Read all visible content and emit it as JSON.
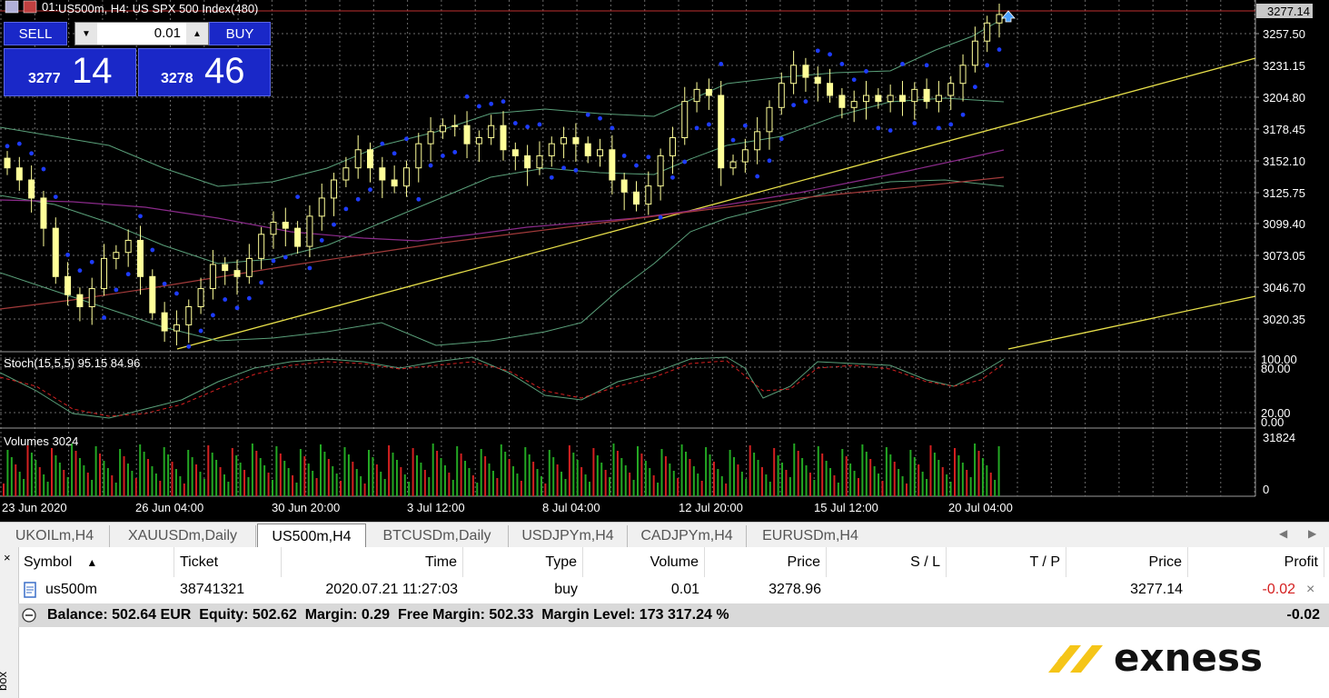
{
  "window": {
    "title": "US500m, H4:  US SPX 500 Index(480)",
    "title_prefix": "01:",
    "current_price_tag": "3277.14"
  },
  "one_click": {
    "sell_label": "SELL",
    "buy_label": "BUY",
    "lot": "0.01",
    "bid_small": "3277",
    "bid_big": "14",
    "ask_small": "3278",
    "ask_big": "46",
    "arrow_down": "▼",
    "arrow_up": "▲"
  },
  "price_axis": [
    "3257.50",
    "3231.15",
    "3204.80",
    "3178.45",
    "3152.10",
    "3125.75",
    "3099.40",
    "3073.05",
    "3046.70",
    "3020.35"
  ],
  "time_axis": [
    "23 Jun 2020",
    "26 Jun 04:00",
    "30 Jun 20:00",
    "3 Jul 12:00",
    "8 Jul 04:00",
    "12 Jul 20:00",
    "15 Jul 12:00",
    "20 Jul 04:00"
  ],
  "stochastic": {
    "label": "Stoch(15,5,5) 95.15 84.96",
    "levels": [
      "100.00",
      "80.00",
      "20.00",
      "0.00"
    ]
  },
  "volumes": {
    "label": "Volumes 3024",
    "levels": [
      "31824",
      "0"
    ]
  },
  "colors": {
    "bull_candle": "#ffff99",
    "bear_candle": "#ffff99",
    "parabolic_sar": "#1e3cff",
    "bollinger": "#5aa07a",
    "trendline": "#e8e04a",
    "ma_purple": "#8a2a8a",
    "ma_red": "#a23a3a",
    "stoch_main": "#5aa07a",
    "stoch_signal": "#d42020",
    "volume_up": "#23a823",
    "volume_down": "#d42020",
    "button_blue": "#1a28c8"
  },
  "chart_data": {
    "type": "candlestick",
    "symbol": "US500m",
    "timeframe": "H4",
    "ylim": [
      3000,
      3280
    ],
    "close_points": [
      3150,
      3140,
      3125,
      3100,
      3060,
      3045,
      3035,
      3050,
      3075,
      3080,
      3090,
      3060,
      3030,
      3015,
      3020,
      3035,
      3050,
      3070,
      3065,
      3060,
      3075,
      3095,
      3105,
      3100,
      3085,
      3110,
      3125,
      3140,
      3150,
      3165,
      3150,
      3140,
      3135,
      3150,
      3170,
      3180,
      3185,
      3185,
      3170,
      3175,
      3185,
      3165,
      3160,
      3150,
      3160,
      3170,
      3175,
      3170,
      3160,
      3165,
      3140,
      3130,
      3120,
      3135,
      3160,
      3175,
      3205,
      3215,
      3210,
      3150,
      3155,
      3165,
      3180,
      3200,
      3220,
      3235,
      3225,
      3220,
      3210,
      3200,
      3205,
      3210,
      3205,
      3210,
      3205,
      3215,
      3205,
      3210,
      3220,
      3235,
      3255,
      3270,
      3277
    ]
  },
  "tabs": [
    "UKOILm,H4",
    "XAUUSDm,Daily",
    "US500m,H4",
    "BTCUSDm,Daily",
    "USDJPYm,H4",
    "CADJPYm,H4",
    "EURUSDm,H4"
  ],
  "tab_nav": {
    "left": "◀",
    "right": "▶"
  },
  "terminal": {
    "close": "×",
    "side_label": "box",
    "sort_arrow": "▲",
    "headers": [
      "Symbol",
      "Ticket",
      "Time",
      "Type",
      "Volume",
      "Price",
      "S / L",
      "T / P",
      "Price",
      "Profit"
    ],
    "row": {
      "symbol": "us500m",
      "ticket": "38741321",
      "time": "2020.07.21 11:27:03",
      "type": "buy",
      "volume": "0.01",
      "price": "3278.96",
      "sl": "",
      "tp": "",
      "current_price": "3277.14",
      "profit": "-0.02",
      "close": "×"
    },
    "balance": {
      "text": "Balance: 502.64 EUR  Equity: 502.62  Margin: 0.29  Free Margin: 502.33  Margin Level: 173 317.24 %",
      "total": "-0.02"
    }
  },
  "brand": {
    "name": "exness"
  }
}
